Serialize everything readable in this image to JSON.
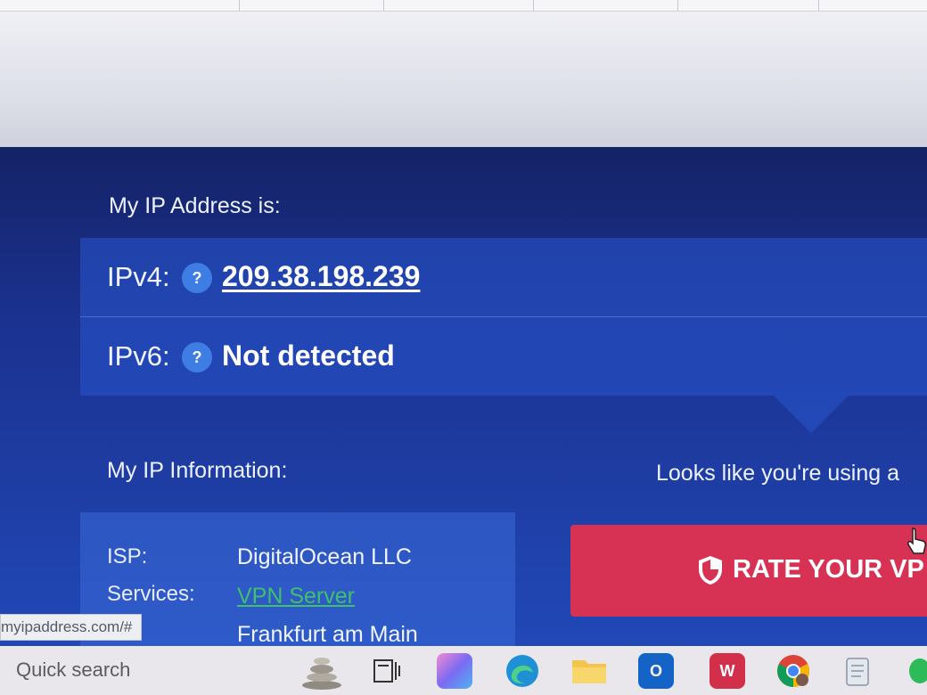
{
  "header": {
    "title": "My IP Address is:"
  },
  "ip": {
    "v4_label": "IPv4:",
    "v4_value": "209.38.198.239",
    "v6_label": "IPv6:",
    "v6_value": "Not detected",
    "help_glyph": "?"
  },
  "info": {
    "title": "My IP Information:",
    "vpn_notice": "Looks like you're using a",
    "rows": [
      {
        "key": "ISP:",
        "value": "DigitalOcean LLC"
      },
      {
        "key": "Services:",
        "value": "VPN Server"
      },
      {
        "key": "",
        "value": "Frankfurt am Main"
      }
    ]
  },
  "cta": {
    "label": "RATE YOUR VP"
  },
  "status_bar": {
    "url": "myipaddress.com/#"
  },
  "taskbar": {
    "search_placeholder": "Quick search",
    "icons": [
      "stones-widget-icon",
      "task-view-icon",
      "copilot-icon",
      "edge-icon",
      "file-explorer-icon",
      "outlook-icon",
      "wps-office-icon",
      "chrome-icon",
      "notepad-icon"
    ]
  },
  "colors": {
    "panel_top": "#142266",
    "panel_bottom": "#2148b7",
    "help_badge": "#3e7de4",
    "cta": "#d73254",
    "link_green": "#3fc06a"
  }
}
